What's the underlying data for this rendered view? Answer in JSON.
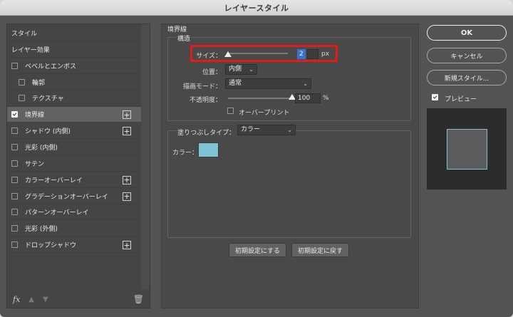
{
  "window": {
    "title": "レイヤースタイル"
  },
  "styles_list": {
    "items": [
      {
        "label": "スタイル",
        "checkbox": false,
        "checked": false,
        "plus": false,
        "selected": false
      },
      {
        "label": "レイヤー効果",
        "checkbox": false,
        "checked": false,
        "plus": false,
        "selected": false
      },
      {
        "label": "ベベルとエンボス",
        "checkbox": true,
        "checked": false,
        "plus": false,
        "selected": false
      },
      {
        "label": "輪郭",
        "checkbox": true,
        "checked": false,
        "plus": false,
        "selected": false,
        "indent": true
      },
      {
        "label": "テクスチャ",
        "checkbox": true,
        "checked": false,
        "plus": false,
        "selected": false,
        "indent": true
      },
      {
        "label": "境界線",
        "checkbox": true,
        "checked": true,
        "plus": true,
        "selected": true
      },
      {
        "label": "シャドウ (内側)",
        "checkbox": true,
        "checked": false,
        "plus": true,
        "selected": false
      },
      {
        "label": "光彩 (内側)",
        "checkbox": true,
        "checked": false,
        "plus": false,
        "selected": false
      },
      {
        "label": "サテン",
        "checkbox": true,
        "checked": false,
        "plus": false,
        "selected": false
      },
      {
        "label": "カラーオーバーレイ",
        "checkbox": true,
        "checked": false,
        "plus": true,
        "selected": false
      },
      {
        "label": "グラデーションオーバーレイ",
        "checkbox": true,
        "checked": false,
        "plus": true,
        "selected": false
      },
      {
        "label": "パターンオーバーレイ",
        "checkbox": true,
        "checked": false,
        "plus": false,
        "selected": false
      },
      {
        "label": "光彩 (外側)",
        "checkbox": true,
        "checked": false,
        "plus": false,
        "selected": false
      },
      {
        "label": "ドロップシャドウ",
        "checkbox": true,
        "checked": false,
        "plus": true,
        "selected": false
      }
    ],
    "footer": {
      "fx_label": "fx"
    }
  },
  "stroke": {
    "section_title": "境界線",
    "structure_title": "構造",
    "size_label": "サイズ：",
    "size_value": "2",
    "size_unit": "px",
    "position_label": "位置：",
    "position_value": "内側",
    "blend_label": "描画モード：",
    "blend_value": "通常",
    "opacity_label": "不透明度：",
    "opacity_value": "100",
    "opacity_unit": "%",
    "opacity_level": 1.0,
    "size_level": 0.0,
    "overprint_label": "オーバープリント",
    "overprint_checked": false,
    "fill_type_label": "塗りつぶしタイプ：",
    "fill_type_value": "カラー",
    "color_label": "カラー：",
    "color_value": "#7fc3d4",
    "make_default_label": "初期設定にする",
    "reset_default_label": "初期設定に戻す"
  },
  "actions": {
    "ok_label": "OK",
    "cancel_label": "キャンセル",
    "new_style_label": "新規スタイル...",
    "preview_label": "プレビュー",
    "preview_checked": true
  },
  "colors": {
    "highlight": "#e21a1a",
    "stroke_color": "#7fc3d4",
    "selection": "#3b6fd0"
  }
}
